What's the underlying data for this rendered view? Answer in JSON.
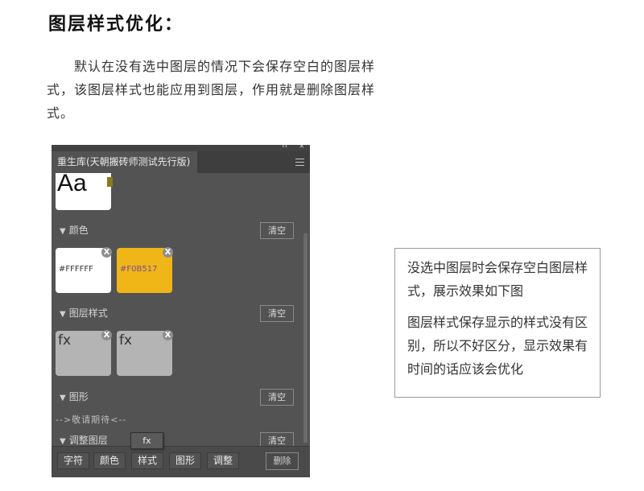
{
  "heading": "图层样式优化：",
  "paragraph": "默认在没有选中图层的情况下会保存空白的图层样式，该图层样式也能应用到图层，作用就是删除图层样式。",
  "panel": {
    "tab_title": "重生库(天朝搬砖师测试先行版)",
    "top_controls": [
      "‹‹",
      "×"
    ],
    "preview_text": "Aa",
    "sections": {
      "color": {
        "title": "颜色",
        "clear_label": "清空"
      },
      "layer_style": {
        "title": "图层样式",
        "clear_label": "清空"
      },
      "shape": {
        "title": "图形",
        "clear_label": "清空"
      },
      "adjustment": {
        "title": "调整图层",
        "clear_label": "清空"
      }
    },
    "swatches": [
      {
        "hex_label": "#FFFFFF",
        "color": "#FFFFFF",
        "close": "X"
      },
      {
        "hex_label": "#F0B517",
        "color": "#F0B517",
        "close": "X"
      }
    ],
    "style_cards": [
      {
        "label": "fx",
        "close": "X"
      },
      {
        "label": "fx",
        "close": "X"
      }
    ],
    "coming_soon": "-->敬请期待<--",
    "tooltip": "fx",
    "bottom_tabs": [
      "字符",
      "颜色",
      "样式",
      "图形",
      "调整"
    ],
    "delete_label": "删除"
  },
  "note": {
    "p1": "没选中图层时会保存空白图层样式，展示效果如下图",
    "p2": "图层样式保存显示的样式没有区别，所以不好区分，显示效果有时间的话应该会优化"
  },
  "colors": {
    "panel_bg": "#535353",
    "accent": "#F0B517",
    "olive_marker": "#8A7A1C"
  }
}
